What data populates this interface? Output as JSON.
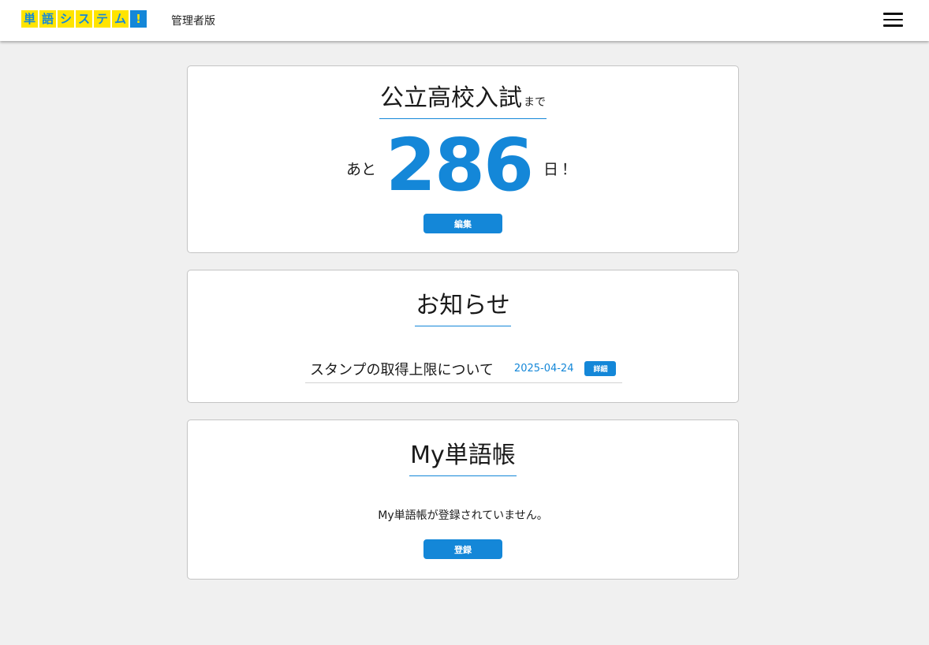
{
  "header": {
    "logo_chars": [
      "単",
      "語",
      "シ",
      "ス",
      "テ",
      "ム",
      "!"
    ],
    "admin_label": "管理者版",
    "menu_icon": "hamburger-menu-icon"
  },
  "exam_card": {
    "title": "公立高校入試",
    "title_suffix": "まで",
    "prefix": "あと",
    "days": "286",
    "suffix": "日！",
    "edit_label": "編集"
  },
  "news_card": {
    "title": "お知らせ",
    "items": [
      {
        "title": "スタンプの取得上限について",
        "date": "2025-04-24",
        "detail_label": "詳細"
      }
    ]
  },
  "mywords_card": {
    "title": "My単語帳",
    "empty_message": "My単語帳が登録されていません。",
    "register_label": "登録"
  },
  "colors": {
    "accent": "#1487d8",
    "logo_yellow": "#ffe400",
    "background": "#f0f0f0"
  }
}
